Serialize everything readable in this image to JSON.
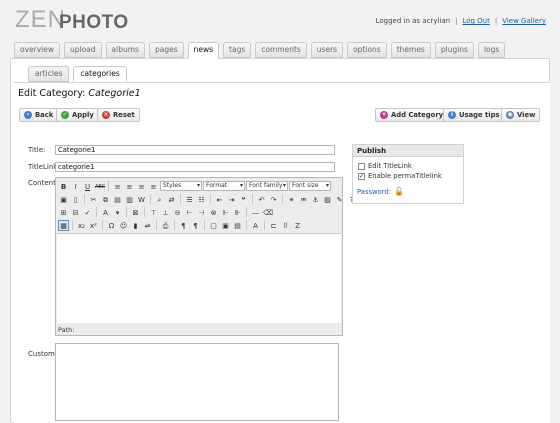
{
  "logo": {
    "part1": "ZEN",
    "part2": "PHOTO"
  },
  "userbar": {
    "logged_in": "Logged in as acrylian",
    "logout": "Log Out",
    "view_gallery": "View Gallery"
  },
  "main_tabs": [
    "overview",
    "upload",
    "albums",
    "pages",
    "news",
    "tags",
    "comments",
    "users",
    "options",
    "themes",
    "plugins",
    "logs"
  ],
  "active_main_tab": "news",
  "sub_tabs": [
    "articles",
    "categories"
  ],
  "active_sub_tab": "categories",
  "page_title": {
    "prefix": "Edit Category: ",
    "name": "Categorie1"
  },
  "buttons": {
    "back": "Back",
    "apply": "Apply",
    "reset": "Reset",
    "add_category": "Add Category",
    "usage_tips": "Usage tips",
    "view": "View"
  },
  "form": {
    "title_label": "Title:",
    "title_value": "Categorie1",
    "titlelink_label": "TitleLink:",
    "titlelink_value": "categorie1",
    "content_label": "Content:",
    "custom_label": "Custom:"
  },
  "editor": {
    "styles": "Styles",
    "format": "Format",
    "font_family": "Font family",
    "font_size": "Font size",
    "path_label": "Path:"
  },
  "publish": {
    "header": "Publish",
    "edit_titlelink": "Edit TitleLink",
    "enable_perma": "Enable permaTitlelink",
    "password": "Password:"
  },
  "colors": {
    "link": "#1a5fb4",
    "back": "#3f7fd4",
    "apply": "#3aa53a",
    "reset": "#d23b3b",
    "add": "#c23a8a",
    "usage": "#3f7fd4"
  }
}
